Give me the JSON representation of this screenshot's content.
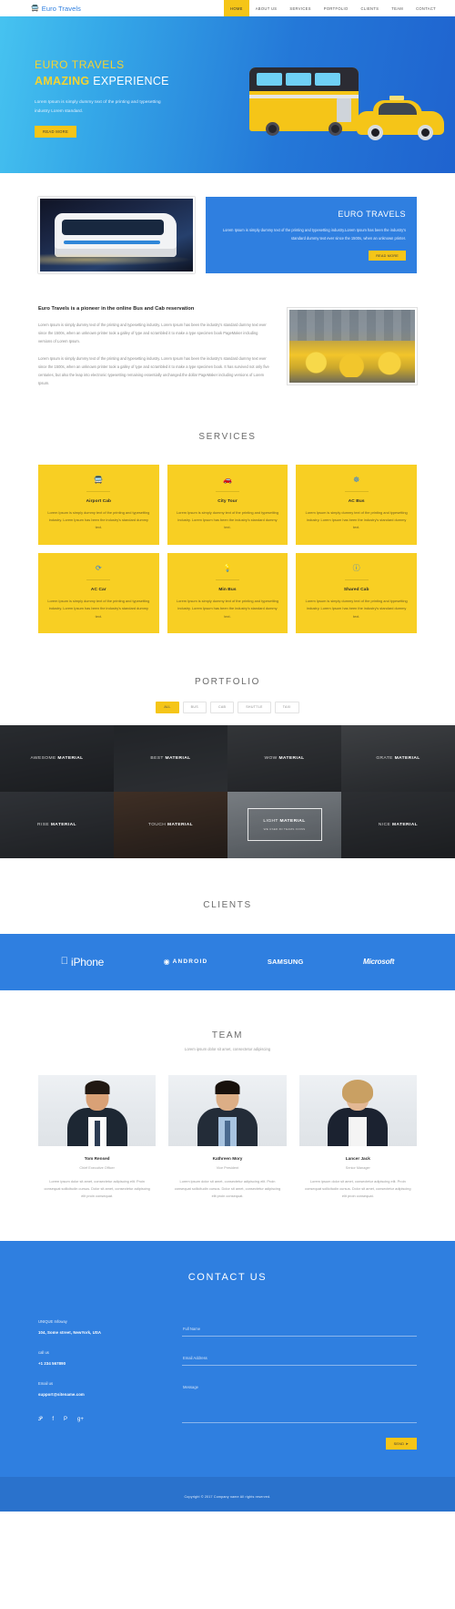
{
  "header": {
    "logo_icon": "bus-icon",
    "logo_text": "Euro Travels",
    "nav": [
      {
        "label": "HOME",
        "active": true
      },
      {
        "label": "ABOUT US",
        "active": false
      },
      {
        "label": "SERVICES",
        "active": false
      },
      {
        "label": "PORTFOLIO",
        "active": false
      },
      {
        "label": "CLIENTS",
        "active": false
      },
      {
        "label": "TEAM",
        "active": false
      },
      {
        "label": "CONTACT",
        "active": false
      }
    ]
  },
  "hero": {
    "title_line1": "EURO TRAVELS",
    "title_strong": "AMAZING",
    "title_rest": " EXPERIENCE",
    "paragraph": "Lorem Ipsum is simply dummy text of the printing and typesetting industry Lorem standard.",
    "button": "READ MORE"
  },
  "feature": {
    "title": "EURO TRAVELS",
    "paragraph": "Lorem Ipsum is simply dummy text of the printing and typesetting industry.Lorem Ipsum has been the industry's standard dummy text ever since the 1500s, when an unknown printer.",
    "button": "READ MORE"
  },
  "about": {
    "heading": "Euro Travels is a pioneer in the online Bus and Cab reservation",
    "paragraph1": "Lorem Ipsum is simply dummy text of the printing and typesetting industry. Lorem Ipsum has been the industry's standard dummy text ever since the 1500s, when an unknown printer took a galley of type and scrambled it to make a type specimen book PageMaker including versions of Lorem Ipsum.",
    "paragraph2": "Lorem Ipsum is simply dummy text of the printing and typesetting industry. Lorem Ipsum has been the industry's standard dummy text ever since the 1500s, when an unknown printer took a galley of type and scrambled it to make a type specimen book. It has survived not only five centuries, but also the leap into electronic typesetting remaining essentially unchanged.the dollar PageMaker including versions of Lorem Ipsum."
  },
  "services": {
    "title": "SERVICES",
    "cards": [
      {
        "icon": "bus-icon",
        "glyph": "🚍",
        "name": "Airport Cab",
        "desc": "Lorem Ipsum is simply dummy text of the printing and typesetting industry. Lorem Ipsum has been the industry's standard dummy text."
      },
      {
        "icon": "car-icon",
        "glyph": "🚗",
        "name": "City Tour",
        "desc": "Lorem Ipsum is simply dummy text of the printing and typesetting industry. Lorem Ipsum has been the industry's standard dummy text."
      },
      {
        "icon": "compass-icon",
        "glyph": "☸",
        "name": "AC Bus",
        "desc": "Lorem Ipsum is simply dummy text of the printing and typesetting industry. Lorem Ipsum has been the industry's standard dummy text."
      },
      {
        "icon": "clock-refresh-icon",
        "glyph": "⟳",
        "name": "AC Car",
        "desc": "Lorem Ipsum is simply dummy text of the printing and typesetting industry. Lorem Ipsum has been the industry's standard dummy text."
      },
      {
        "icon": "lightbulb-icon",
        "glyph": "💡",
        "name": "Min Bus",
        "desc": "Lorem Ipsum is simply dummy text of the printing and typesetting industry. Lorem Ipsum has been the industry's standard dummy text."
      },
      {
        "icon": "info-icon",
        "glyph": "ⓘ",
        "name": "Shared Cab",
        "desc": "Lorem Ipsum is simply dummy text of the printing and typesetting industry. Lorem Ipsum has been the industry's standard dummy text."
      }
    ]
  },
  "portfolio": {
    "title": "PORTFOLIO",
    "filters": [
      {
        "label": "ALL",
        "active": true
      },
      {
        "label": "BUS",
        "active": false
      },
      {
        "label": "CAB",
        "active": false
      },
      {
        "label": "SHUTTLE",
        "active": false
      },
      {
        "label": "TAXI",
        "active": false
      }
    ],
    "tiles": [
      {
        "lead": "AWESOME ",
        "bold": "MATERIAL",
        "sub": "",
        "light": false,
        "tone": "t1"
      },
      {
        "lead": "BEST ",
        "bold": "MATERIAL",
        "sub": "",
        "light": false,
        "tone": "t2"
      },
      {
        "lead": "WOW ",
        "bold": "MATERIAL",
        "sub": "",
        "light": false,
        "tone": "t3"
      },
      {
        "lead": "GRATE ",
        "bold": "MATERIAL",
        "sub": "",
        "light": false,
        "tone": "t4"
      },
      {
        "lead": "RISE ",
        "bold": "MATERIAL",
        "sub": "",
        "light": false,
        "tone": "t5"
      },
      {
        "lead": "TOUCH ",
        "bold": "MATERIAL",
        "sub": "",
        "light": false,
        "tone": "t6"
      },
      {
        "lead": "LIGHT ",
        "bold": "MATERIAL",
        "sub": "WE USED 3D TEAMS ICONS",
        "light": true,
        "tone": "t7"
      },
      {
        "lead": "NICE ",
        "bold": "MATERIAL",
        "sub": "",
        "light": false,
        "tone": "t8"
      }
    ]
  },
  "clients": {
    "title": "CLIENTS",
    "logos": [
      {
        "name": "iPhone",
        "icon": "apple-logo-icon",
        "glyph": ""
      },
      {
        "name": "ANDROID",
        "icon": "android-logo-icon",
        "glyph": "⬢"
      },
      {
        "name": "SAMSUNG",
        "icon": "samsung-logo-icon",
        "glyph": ""
      },
      {
        "name": "Microsoft",
        "icon": "microsoft-logo-icon",
        "glyph": ""
      }
    ]
  },
  "team": {
    "title": "TEAM",
    "subtitle": "Lorem ipsum dolor sit amet, consectetur adipiscing",
    "members": [
      {
        "name": "Tom Rensed",
        "role": "Chief Executive Officer",
        "bio": "Lorem ipsum dolor sit amet, consectetur adipiscing elit. Proin consequat sollicitudin cursus. Dolor sit amet, consectetur adipiscing elit proin consequat."
      },
      {
        "name": "Kathreen Mory",
        "role": "Vice President",
        "bio": "Lorem ipsum dolor sit amet, consectetur adipiscing elit. Proin consequat sollicitudin cursus. Dolor sit amet, consectetur adipiscing elit proin consequat."
      },
      {
        "name": "Lancer Jack",
        "role": "Senior Manager",
        "bio": "Lorem ipsum dolor sit amet, consectetur adipiscing elit. Proin consequat sollicitudin cursus. Dolor sit amet, consectetur adipiscing elit proin consequat."
      }
    ]
  },
  "contact": {
    "title": "CONTACT US",
    "company": "UNIQUE Infoway",
    "address": "104, Some street, NewYork, USA",
    "call_label": "call us",
    "phone": "+1 234 567890",
    "email_label": "Email us",
    "email": "support@sitename.com",
    "social": [
      {
        "name": "twitter-icon",
        "glyph": "🐦"
      },
      {
        "name": "facebook-icon",
        "glyph": "f"
      },
      {
        "name": "pinterest-icon",
        "glyph": "𝑃"
      },
      {
        "name": "google-plus-icon",
        "glyph": "g+"
      }
    ],
    "form": {
      "name_placeholder": "Full Name",
      "email_placeholder": "Email Address",
      "message_placeholder": "Message",
      "send_label": "SEND ➤"
    }
  },
  "footer": {
    "copyright": "Copyright © 2017 Company name All rights reserved."
  },
  "colors": {
    "brand_blue": "#2f7fe0",
    "accent_yellow": "#f5c518",
    "dark": "#2b2b2b"
  }
}
